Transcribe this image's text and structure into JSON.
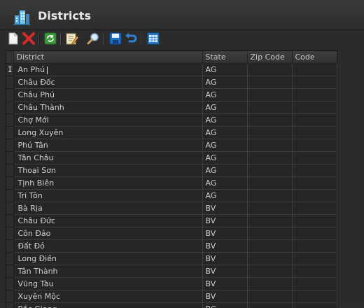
{
  "window": {
    "title": "Districts"
  },
  "toolbar": {
    "buttons": [
      {
        "name": "new-record-button",
        "icon": "new-document-icon"
      },
      {
        "name": "delete-record-button",
        "icon": "delete-x-icon"
      },
      {
        "name": "refresh-button",
        "icon": "refresh-icon"
      },
      {
        "name": "edit-record-button",
        "icon": "edit-pencil-icon"
      },
      {
        "name": "search-button",
        "icon": "magnifier-icon"
      },
      {
        "name": "save-button",
        "icon": "save-disk-icon"
      },
      {
        "name": "undo-button",
        "icon": "undo-arrow-icon"
      },
      {
        "name": "table-view-button",
        "icon": "grid-icon"
      }
    ]
  },
  "grid": {
    "columns": [
      "District",
      "State",
      "Zip Code",
      "Code"
    ],
    "editing_row_marker": "I",
    "rows": [
      {
        "district": "An Phú",
        "state": "AG",
        "zip": "",
        "code": ""
      },
      {
        "district": "Châu Đốc",
        "state": "AG",
        "zip": "",
        "code": ""
      },
      {
        "district": "Châu Phú",
        "state": "AG",
        "zip": "",
        "code": ""
      },
      {
        "district": "Châu Thành",
        "state": "AG",
        "zip": "",
        "code": ""
      },
      {
        "district": "Chợ Mới",
        "state": "AG",
        "zip": "",
        "code": ""
      },
      {
        "district": "Long Xuyên",
        "state": "AG",
        "zip": "",
        "code": ""
      },
      {
        "district": "Phú Tân",
        "state": "AG",
        "zip": "",
        "code": ""
      },
      {
        "district": "Tân Châu",
        "state": "AG",
        "zip": "",
        "code": ""
      },
      {
        "district": "Thoại Sơn",
        "state": "AG",
        "zip": "",
        "code": ""
      },
      {
        "district": "Tịnh Biên",
        "state": "AG",
        "zip": "",
        "code": ""
      },
      {
        "district": "Tri Tôn",
        "state": "AG",
        "zip": "",
        "code": ""
      },
      {
        "district": "Bà Rịa",
        "state": "BV",
        "zip": "",
        "code": ""
      },
      {
        "district": "Châu Đức",
        "state": "BV",
        "zip": "",
        "code": ""
      },
      {
        "district": "Côn Đảo",
        "state": "BV",
        "zip": "",
        "code": ""
      },
      {
        "district": "Đất Đỏ",
        "state": "BV",
        "zip": "",
        "code": ""
      },
      {
        "district": "Long Điền",
        "state": "BV",
        "zip": "",
        "code": ""
      },
      {
        "district": "Tân Thành",
        "state": "BV",
        "zip": "",
        "code": ""
      },
      {
        "district": "Vũng Tàu",
        "state": "BV",
        "zip": "",
        "code": ""
      },
      {
        "district": "Xuyên Mộc",
        "state": "BV",
        "zip": "",
        "code": ""
      },
      {
        "district": "Bắc Giang",
        "state": "BG",
        "zip": "",
        "code": ""
      }
    ]
  }
}
